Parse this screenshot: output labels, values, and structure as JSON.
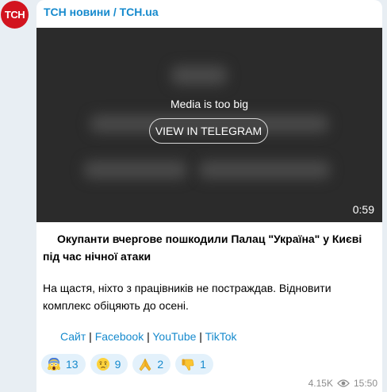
{
  "channel": {
    "avatar_text": "ТСН",
    "name": "ТСН новини / TCH.ua"
  },
  "media": {
    "message": "Media is too big",
    "button_label": "VIEW IN TELEGRAM",
    "duration": "0:59"
  },
  "post": {
    "headline": "Окупанти вчергове пошкодили Палац \"Україна\" у Києві під час нічної атаки",
    "body": "На щастя, ніхто з працівників не постраждав. Відновити комплекс обіцяють до осені."
  },
  "links": [
    {
      "label": "Сайт"
    },
    {
      "label": "Facebook"
    },
    {
      "label": "YouTube"
    },
    {
      "label": "TikTok"
    }
  ],
  "link_separator": " | ",
  "reactions": [
    {
      "icon": "screaming-face-icon",
      "count": "13"
    },
    {
      "icon": "sad-face-icon",
      "count": "9"
    },
    {
      "icon": "folded-hands-icon",
      "count": "2"
    },
    {
      "icon": "thumbs-down-icon",
      "count": "1"
    }
  ],
  "meta": {
    "views": "4.15K",
    "time": "15:50"
  },
  "colors": {
    "accent": "#168acd",
    "avatar_bg": "#d2141f",
    "reaction_bg": "#e3f1fb"
  }
}
